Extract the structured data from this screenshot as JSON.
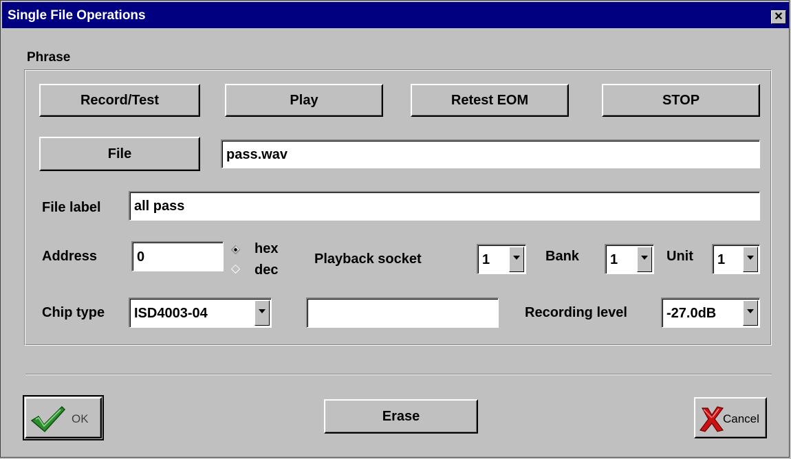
{
  "window": {
    "title": "Single File Operations",
    "close_glyph": "✕"
  },
  "phrase": {
    "group_label": "Phrase",
    "buttons": {
      "record_test": "Record/Test",
      "play": "Play",
      "retest_eom": "Retest EOM",
      "stop": "STOP",
      "file": "File"
    },
    "file_value": "pass.wav",
    "file_label": {
      "label": "File label",
      "value": "all pass"
    },
    "address": {
      "label": "Address",
      "value": "0",
      "radio_hex": "hex",
      "radio_dec": "dec",
      "selected": "hex"
    },
    "playback_socket": {
      "label": "Playback socket",
      "value": "1"
    },
    "bank": {
      "label": "Bank",
      "value": "1"
    },
    "unit": {
      "label": "Unit",
      "value": "1"
    },
    "chip_type": {
      "label": "Chip type",
      "value": "ISD4003-04"
    },
    "chip_info_value": "",
    "recording_level": {
      "label": "Recording level",
      "value": "-27.0dB"
    }
  },
  "footer": {
    "ok_label": "OK",
    "erase_label": "Erase",
    "cancel_label": "Cancel"
  },
  "icons": {
    "ok": "checkmark-icon",
    "cancel": "red-x-icon",
    "arrow": "chevron-down-icon"
  },
  "colors": {
    "title_bar": "#000080",
    "face": "#c0c0c0",
    "check_green": "#2e8b2e",
    "cancel_red": "#cc1111"
  }
}
